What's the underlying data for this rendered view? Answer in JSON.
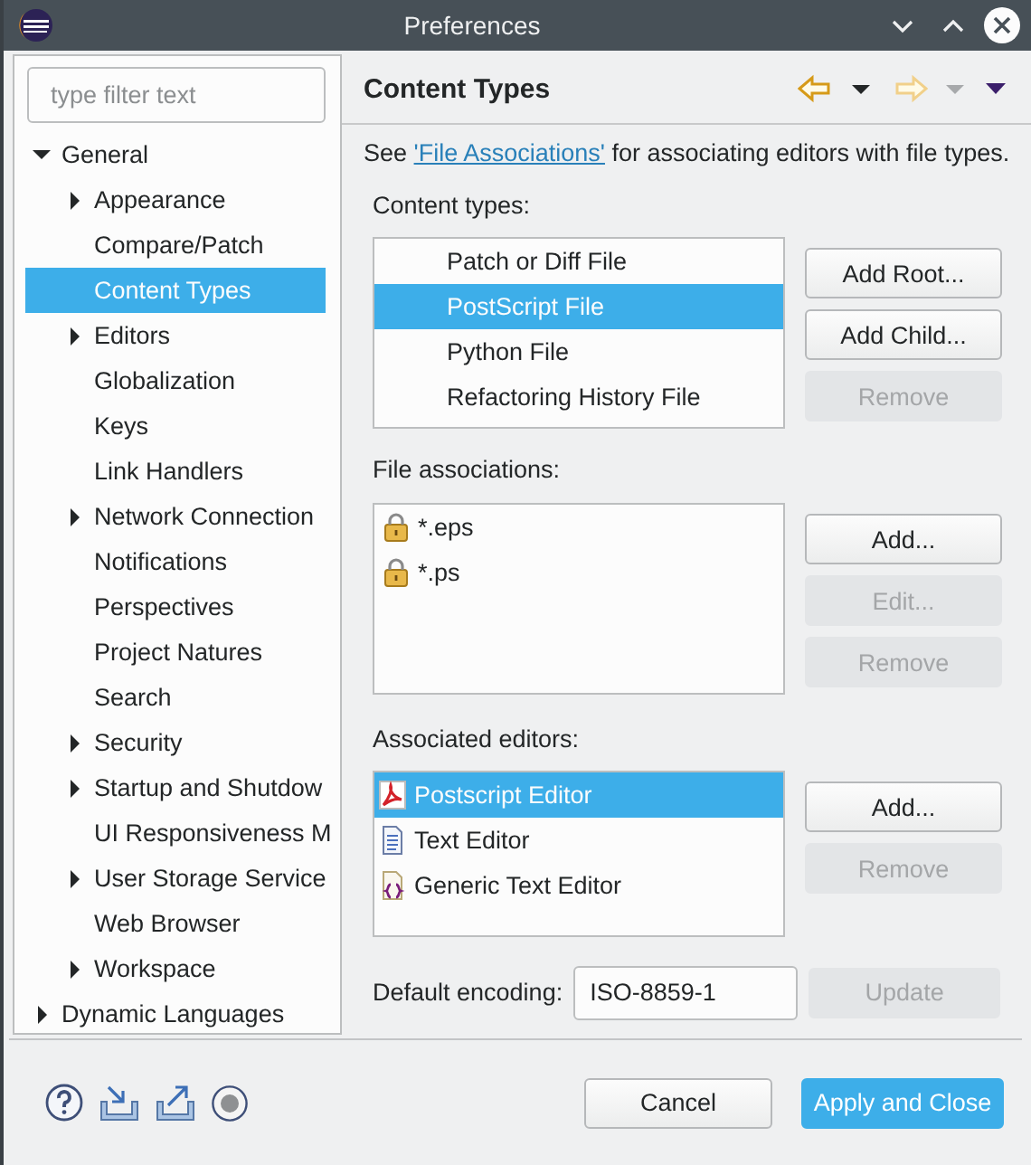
{
  "window": {
    "title": "Preferences"
  },
  "filter": {
    "placeholder": "type filter text"
  },
  "tree": [
    {
      "label": "General",
      "kind": "node",
      "expanded": true,
      "selected": false,
      "children": [
        {
          "label": "Appearance",
          "kind": "node",
          "expanded": false,
          "selected": false
        },
        {
          "label": "Compare/Patch",
          "kind": "leaf",
          "selected": false
        },
        {
          "label": "Content Types",
          "kind": "leaf",
          "selected": true
        },
        {
          "label": "Editors",
          "kind": "node",
          "expanded": false,
          "selected": false
        },
        {
          "label": "Globalization",
          "kind": "leaf",
          "selected": false
        },
        {
          "label": "Keys",
          "kind": "leaf",
          "selected": false
        },
        {
          "label": "Link Handlers",
          "kind": "leaf",
          "selected": false
        },
        {
          "label": "Network Connection",
          "kind": "node",
          "expanded": false,
          "selected": false
        },
        {
          "label": "Notifications",
          "kind": "leaf",
          "selected": false
        },
        {
          "label": "Perspectives",
          "kind": "leaf",
          "selected": false
        },
        {
          "label": "Project Natures",
          "kind": "leaf",
          "selected": false
        },
        {
          "label": "Search",
          "kind": "leaf",
          "selected": false
        },
        {
          "label": "Security",
          "kind": "node",
          "expanded": false,
          "selected": false
        },
        {
          "label": "Startup and Shutdow",
          "kind": "node",
          "expanded": false,
          "selected": false
        },
        {
          "label": "UI Responsiveness M",
          "kind": "leaf",
          "selected": false
        },
        {
          "label": "User Storage Service",
          "kind": "node",
          "expanded": false,
          "selected": false
        },
        {
          "label": "Web Browser",
          "kind": "leaf",
          "selected": false
        },
        {
          "label": "Workspace",
          "kind": "node",
          "expanded": false,
          "selected": false
        }
      ]
    },
    {
      "label": "Dynamic Languages",
      "kind": "node",
      "expanded": false,
      "selected": false
    }
  ],
  "page": {
    "title": "Content Types",
    "history": [
      {
        "kind": "back",
        "disabled": false
      },
      {
        "kind": "forward",
        "disabled": true
      }
    ],
    "intro": {
      "before": "See ",
      "link": "'File Associations'",
      "after": " for associating editors with file types."
    },
    "sections": [
      {
        "label": "Content types:",
        "kind": "types",
        "items": [
          {
            "label": "Patch or Diff File",
            "selected": false
          },
          {
            "label": "PostScript File",
            "selected": true
          },
          {
            "label": "Python File",
            "selected": false
          },
          {
            "label": "Refactoring History File",
            "selected": false
          }
        ],
        "buttons": [
          {
            "label": "Add Root...",
            "disabled": false
          },
          {
            "label": "Add Child...",
            "disabled": false
          },
          {
            "label": "Remove",
            "disabled": true
          }
        ]
      },
      {
        "label": "File associations:",
        "kind": "files",
        "items": [
          {
            "label": "*.eps",
            "kind": "lock",
            "selected": false
          },
          {
            "label": "*.ps",
            "kind": "lock",
            "selected": false
          }
        ],
        "buttons": [
          {
            "label": "Add...",
            "disabled": false
          },
          {
            "label": "Edit...",
            "disabled": true
          },
          {
            "label": "Remove",
            "disabled": true
          }
        ]
      },
      {
        "label": "Associated editors:",
        "kind": "editors",
        "items": [
          {
            "label": "Postscript Editor",
            "kind": "pdf",
            "selected": true
          },
          {
            "label": "Text Editor",
            "kind": "text",
            "selected": false
          },
          {
            "label": "Generic Text Editor",
            "kind": "generic",
            "selected": false
          }
        ],
        "buttons": [
          {
            "label": "Add...",
            "disabled": false
          },
          {
            "label": "Remove",
            "disabled": true
          }
        ]
      }
    ],
    "encoding": {
      "label": "Default encoding:",
      "value": "ISO-8859-1",
      "button": {
        "label": "Update",
        "disabled": true
      }
    }
  },
  "footer": {
    "buttons": [
      {
        "label": "Cancel",
        "kind": "normal"
      },
      {
        "label": "Apply and Close",
        "kind": "primary"
      }
    ]
  }
}
